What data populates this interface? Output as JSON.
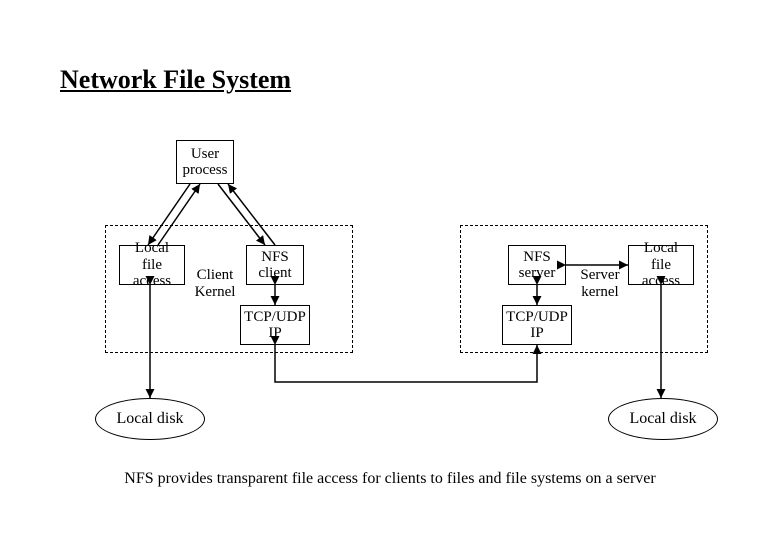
{
  "title": "Network File System",
  "boxes": {
    "user_process": {
      "line1": "User",
      "line2": "process"
    },
    "local_file_access_left": {
      "line1": "Local file",
      "line2": "access"
    },
    "nfs_client": {
      "line1": "NFS",
      "line2": "client"
    },
    "tcpudp_left": {
      "line1": "TCP/UDP",
      "line2": "IP"
    },
    "nfs_server": {
      "line1": "NFS",
      "line2": "server"
    },
    "tcpudp_right": {
      "line1": "TCP/UDP",
      "line2": "IP"
    },
    "local_file_access_right": {
      "line1": "Local file",
      "line2": "access"
    }
  },
  "labels": {
    "client_kernel": {
      "line1": "Client",
      "line2": "Kernel"
    },
    "server_kernel": {
      "line1": "Server",
      "line2": "kernel"
    }
  },
  "disks": {
    "left": "Local disk",
    "right": "Local disk"
  },
  "caption": "NFS provides transparent file access for clients to files and file systems on a server"
}
